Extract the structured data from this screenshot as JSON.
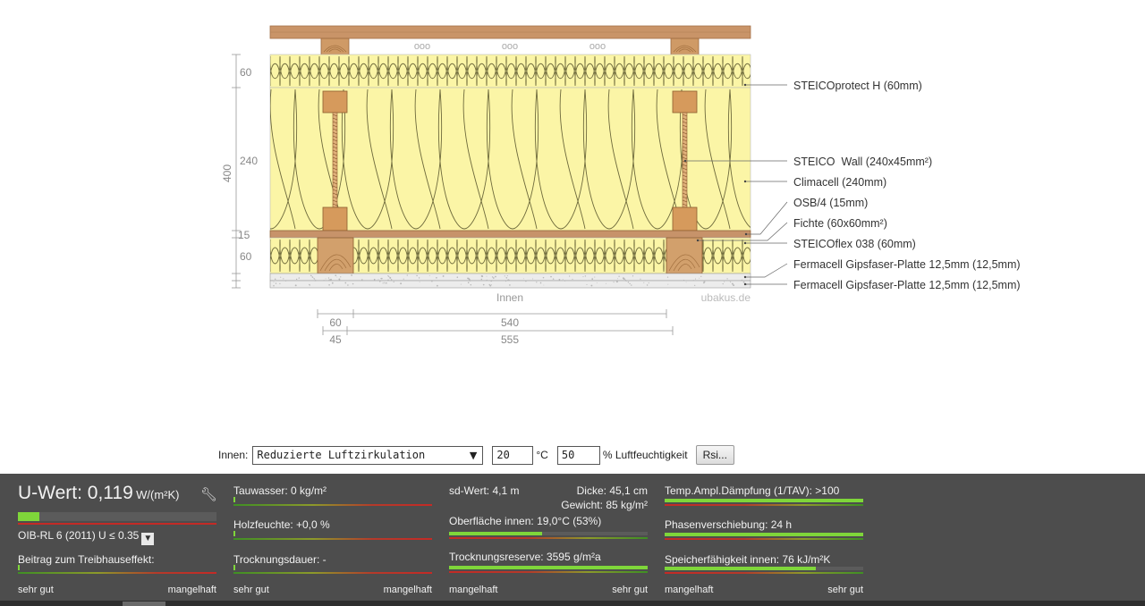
{
  "diagram": {
    "layers": [
      {
        "label": "STEICOprotect H (60mm)"
      },
      {
        "label": "STEICO  Wall (240x45mm²)"
      },
      {
        "label": "Climacell (240mm)"
      },
      {
        "label": "OSB/4 (15mm)"
      },
      {
        "label": "Fichte (60x60mm²)"
      },
      {
        "label": "STEICOflex 038 (60mm)"
      },
      {
        "label": "Fermacell Gipsfaser-Platte 12,5mm (12,5mm)"
      },
      {
        "label": "Fermacell Gipsfaser-Platte 12,5mm (12,5mm)"
      }
    ],
    "dims_left": [
      "60",
      "240",
      "15",
      "60"
    ],
    "dim_total": "400",
    "dims_bottom": [
      "60",
      "540",
      "45",
      "555"
    ],
    "inside_label": "Innen",
    "watermark": "ubakus.de",
    "circle_marks": [
      "ooo",
      "ooo",
      "ooo"
    ]
  },
  "controls": {
    "inside_label": "Innen:",
    "select_value": "Reduzierte Luftzirkulation",
    "temp_value": "20",
    "temp_unit": "°C",
    "humidity_value": "50",
    "humidity_unit": "% Luftfeuchtigkeit",
    "rsi_button": "Rsi..."
  },
  "results": {
    "uwert_label": "U-Wert: ",
    "uwert_value": "0,119",
    "uwert_unit": "W/(m²K)",
    "uwert_fill": 0.11,
    "oib": "OIB-RL 6 (2011) U ≤ 0.35",
    "treibhaus": "Beitrag zum Treibhauseffekt:",
    "tauwasser": "Tauwasser: 0 kg/m²",
    "holzfeuchte": "Holzfeuchte: +0,0 %",
    "trocknungsdauer": "Trocknungsdauer: -",
    "sdwert": "sd-Wert: 4,1 m",
    "dicke": "Dicke: 45,1 cm",
    "gewicht": "Gewicht: 85 kg/m²",
    "oberflaeche": "Oberfläche innen: 19,0°C (53%)",
    "oberflaeche_fill": 0.47,
    "trocknungsreserve": "Trocknungsreserve: 3595 g/m²a",
    "trocknungsreserve_fill": 1.0,
    "temp_ampl": "Temp.Ampl.Dämpfung (1/TAV): >100",
    "temp_ampl_fill": 1.0,
    "phasen": "Phasenverschiebung: 24 h",
    "phasen_fill": 1.0,
    "speicher": "Speicherfähigkeit innen: 76 kJ/m²K",
    "speicher_fill": 0.76,
    "scale_good": "sehr gut",
    "scale_bad": "mangelhaft"
  }
}
